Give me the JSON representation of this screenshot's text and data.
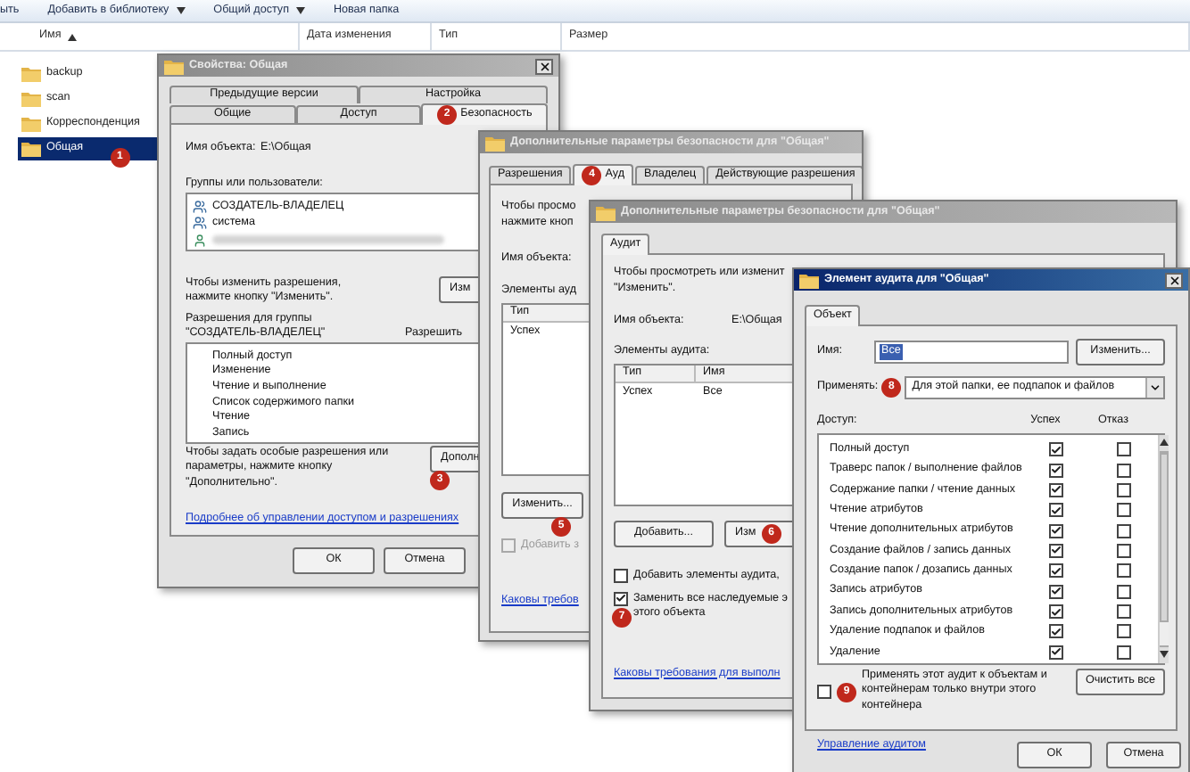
{
  "explorer": {
    "toolbar": [
      {
        "label": "ыть",
        "dropdown": false
      },
      {
        "label": "Добавить в библиотеку",
        "dropdown": true
      },
      {
        "label": "Общий доступ",
        "dropdown": true
      },
      {
        "label": "Новая папка",
        "dropdown": false
      }
    ],
    "columns": [
      {
        "label": "Имя",
        "sorted": true
      },
      {
        "label": "Дата изменения",
        "sorted": false
      },
      {
        "label": "Тип",
        "sorted": false
      },
      {
        "label": "Размер",
        "sorted": false
      }
    ],
    "folders": [
      {
        "name": "backup",
        "selected": false
      },
      {
        "name": "scan",
        "selected": false
      },
      {
        "name": "Корреспонденция",
        "selected": false
      },
      {
        "name": "Общая",
        "selected": true,
        "badge": "1"
      }
    ]
  },
  "properties_window": {
    "title": "Свойства: Общая",
    "active": false,
    "tab_rows": [
      [
        {
          "label": "Предыдущие версии",
          "selected": false
        },
        {
          "label": "Настройка",
          "selected": false
        }
      ],
      [
        {
          "label": "Общие",
          "selected": false
        },
        {
          "label": "Доступ",
          "selected": false
        },
        {
          "label": "Безопасность",
          "selected": true,
          "badge": "2"
        }
      ]
    ],
    "object_label": "Имя объекта:",
    "object_value": "E:\\Общая",
    "groups_label": "Группы или пользователи:",
    "principals": [
      {
        "kind": "group",
        "name": "СОЗДАТЕЛЬ-ВЛАДЕЛЕЦ"
      },
      {
        "kind": "group",
        "name": "система"
      },
      {
        "kind": "blurred"
      }
    ],
    "change_hint": "Чтобы изменить разрешения,\nнажмите кнопку \"Изменить\".",
    "change_button": "Изм",
    "permissions_label": "Разрешения для группы\n\"СОЗДАТЕЛЬ-ВЛАДЕЛЕЦ\"",
    "allow_header": "Разрешить",
    "permissions": [
      "Полный доступ",
      "Изменение",
      "Чтение и выполнение",
      "Список содержимого папки",
      "Чтение",
      "Запись"
    ],
    "advanced_hint": "Чтобы задать особые разрешения или\nпараметры, нажмите кнопку\n\"Дополнительно\".",
    "advanced_button": {
      "label": "Дополн",
      "badge": "3"
    },
    "link": "Подробнее об управлении доступом и разрешениях",
    "buttons": [
      "ОК",
      "Отмена"
    ]
  },
  "advanced_window": {
    "title": "Дополнительные параметры безопасности для \"Общая\"",
    "active": false,
    "tabs": [
      {
        "label": "Разрешения",
        "selected": false
      },
      {
        "label": "Ауд",
        "selected": true,
        "badge": "4"
      },
      {
        "label": "Владелец",
        "selected": false
      },
      {
        "label": "Действующие разрешения",
        "selected": false
      }
    ],
    "hint": "Чтобы просмо\nнажмите кноп",
    "object_label": "Имя объекта:",
    "entries_label": "Элементы ауд",
    "table_header": "Тип",
    "rows": [
      "Успех"
    ],
    "edit_button": {
      "label": "Изменить...",
      "badge": "5"
    },
    "checkbox": {
      "label": "Добавить з",
      "checked": false,
      "disabled": true
    },
    "link": "Каковы требов"
  },
  "audit_window": {
    "title": "Дополнительные параметры безопасности для \"Общая\"",
    "active": false,
    "tabs": [
      {
        "label": "Аудит",
        "selected": true
      }
    ],
    "hint": "Чтобы просмотреть или изменит\n\"Изменить\".",
    "object_label": "Имя объекта:",
    "object_value": "E:\\Общая",
    "entries_label": "Элементы аудита:",
    "columns": [
      "Тип",
      "Имя"
    ],
    "rows": [
      [
        "Успех",
        "Все"
      ]
    ],
    "buttons": [
      {
        "label": "Добавить..."
      },
      {
        "label": "Изм",
        "badge": "6"
      }
    ],
    "checkboxes": [
      {
        "label": "Добавить элементы аудита,",
        "checked": false
      },
      {
        "label": "Заменить все наследуемые э\nэтого объекта",
        "checked": true,
        "badge": "7"
      }
    ],
    "link": "Каковы требования для выполн"
  },
  "entry_window": {
    "title": "Элемент аудита для \"Общая\"",
    "active": true,
    "tabs": [
      {
        "label": "Объект",
        "selected": true
      }
    ],
    "name_label": "Имя:",
    "name_value": "Все",
    "change_button": "Изменить...",
    "apply_label": "Применять:",
    "apply_badge": "8",
    "apply_value": "Для этой папки, ее подпапок и файлов",
    "access_label": "Доступ:",
    "columns": [
      "Успех",
      "Отказ"
    ],
    "access": [
      {
        "name": "Полный доступ",
        "success": true,
        "failure": false
      },
      {
        "name": "Траверс папок / выполнение файлов",
        "success": true,
        "failure": false
      },
      {
        "name": "Содержание папки / чтение данных",
        "success": true,
        "failure": false
      },
      {
        "name": "Чтение атрибутов",
        "success": true,
        "failure": false
      },
      {
        "name": "Чтение дополнительных атрибутов",
        "success": true,
        "failure": false
      },
      {
        "name": "Создание файлов / запись данных",
        "success": true,
        "failure": false
      },
      {
        "name": "Создание папок / дозапись данных",
        "success": true,
        "failure": false
      },
      {
        "name": "Запись атрибутов",
        "success": true,
        "failure": false
      },
      {
        "name": "Запись дополнительных атрибутов",
        "success": true,
        "failure": false
      },
      {
        "name": "Удаление подпапок и файлов",
        "success": true,
        "failure": false
      },
      {
        "name": "Удаление",
        "success": true,
        "failure": false
      }
    ],
    "inner_only": {
      "label": "Применять этот аудит к объектам и\nконтейнерам только внутри этого\nконтейнера",
      "checked": false,
      "badge": "9"
    },
    "clear_button": "Очистить все",
    "link": "Управление аудитом",
    "buttons": [
      "ОК",
      "Отмена"
    ]
  }
}
